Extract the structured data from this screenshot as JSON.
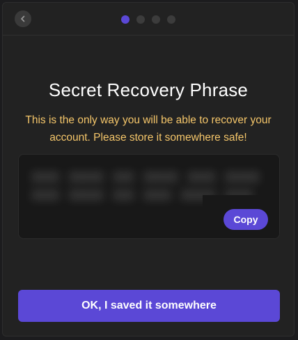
{
  "header": {
    "back_icon": "chevron-left-icon",
    "steps": {
      "total": 4,
      "current": 1
    }
  },
  "title": "Secret Recovery Phrase",
  "warning": "This is the only way you will be able to recover your account. Please store it somewhere safe!",
  "phrase_box": {
    "copy_label": "Copy"
  },
  "primary_button_label": "OK, I saved it somewhere",
  "colors": {
    "accent": "#5b48d6",
    "warning_text": "#f5c66a",
    "background": "#222222"
  }
}
